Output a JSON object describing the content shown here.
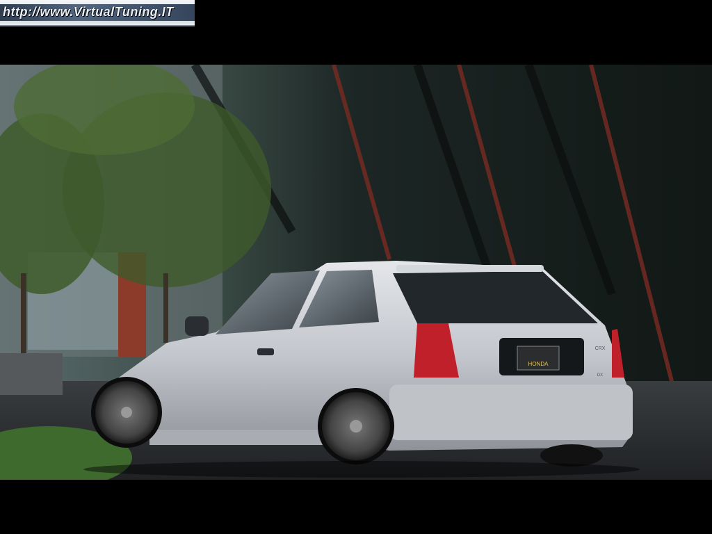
{
  "banner": {
    "text": "http://www.VirtualTuning.IT"
  },
  "car": {
    "badge": "HONDA",
    "model_badge": "CRX",
    "trim_badge": "DX"
  },
  "colors": {
    "background": "#000000",
    "car_body": "#c9ccd1",
    "tail_light": "#c0202a",
    "foliage": "#3e5a2a"
  }
}
